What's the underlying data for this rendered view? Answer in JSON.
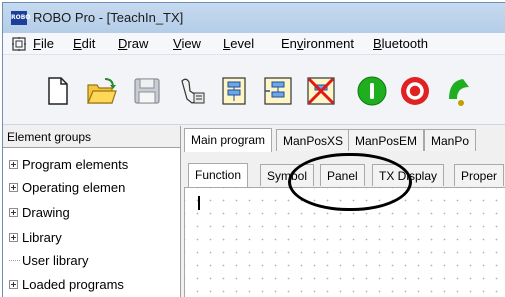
{
  "window": {
    "title": "ROBO Pro - [TeachIn_TX]",
    "app_icon_text": "ROBO"
  },
  "menubar": {
    "items": [
      {
        "pre": "",
        "u": "F",
        "post": "ile"
      },
      {
        "pre": "",
        "u": "E",
        "post": "dit"
      },
      {
        "pre": "",
        "u": "D",
        "post": "raw"
      },
      {
        "pre": "",
        "u": "V",
        "post": "iew"
      },
      {
        "pre": "",
        "u": "L",
        "post": "evel"
      },
      {
        "pre": "En",
        "u": "v",
        "post": "ironment"
      },
      {
        "pre": "",
        "u": "B",
        "post": "luetooth"
      }
    ]
  },
  "toolbar": {
    "buttons": [
      "new-document-icon",
      "open-folder-icon",
      "save-disk-icon",
      "wand-icon",
      "download-program-icon",
      "new-subprogram-icon",
      "delete-subprogram-icon",
      "start-program-icon",
      "stop-program-icon",
      "partial-green-icon"
    ]
  },
  "sidebar": {
    "header": "Element groups",
    "items": [
      {
        "label": "Program elements",
        "expandable": true
      },
      {
        "label": "Operating elemen",
        "expandable": true
      },
      {
        "label": "Drawing",
        "expandable": true
      },
      {
        "label": "Library",
        "expandable": true
      },
      {
        "label": "User library",
        "expandable": false
      },
      {
        "label": "Loaded programs",
        "expandable": true
      }
    ]
  },
  "program_tabs": [
    "Main program",
    "ManPosXS",
    "ManPosEM",
    "ManPo"
  ],
  "view_tabs": [
    "Function",
    "Symbol",
    "Panel",
    "TX Display",
    "Proper"
  ],
  "colors": {
    "accent": "#1c3f9a",
    "go": "#1fae1f",
    "stop": "#e02222"
  }
}
